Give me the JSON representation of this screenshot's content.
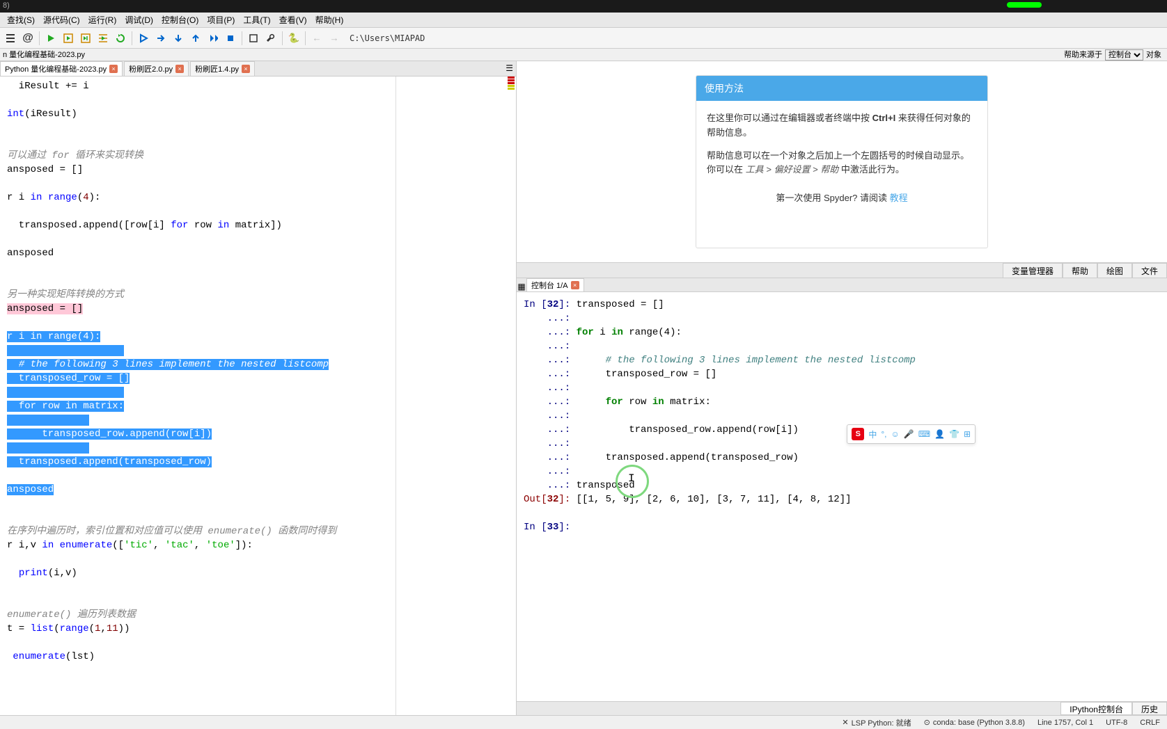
{
  "titlebar": {
    "text": "8)"
  },
  "menu": [
    "查找(S)",
    "源代码(C)",
    "运行(R)",
    "调试(D)",
    "控制台(O)",
    "项目(P)",
    "工具(T)",
    "查看(V)",
    "帮助(H)"
  ],
  "toolbar_path": "C:\\Users\\MIAPAD",
  "breadcrumb_left": "n 量化编程基础-2023.py",
  "breadcrumb_right_label": "帮助来源于",
  "breadcrumb_select": "控制台",
  "breadcrumb_object": "对象",
  "editor_tabs": [
    {
      "label": "Python 量化编程基础-2023.py",
      "active": true
    },
    {
      "label": "粉刷匠2.0.py",
      "active": false
    },
    {
      "label": "粉刷匠1.4.py",
      "active": false
    }
  ],
  "help": {
    "title": "使用方法",
    "p1a": "在这里你可以通过在编辑器或者终端中按 ",
    "p1b": "Ctrl+I",
    "p1c": " 来获得任何对象的帮助信息。",
    "p2a": "帮助信息可以在一个对象之后加上一个左圆括号的时候自动显示。你可以在 ",
    "p2b": "工具 > 偏好设置 > 帮助",
    "p2c": " 中激活此行为。",
    "footer_a": "第一次使用 Spyder? 请阅读 ",
    "footer_link": "教程"
  },
  "right_tabs": [
    "变量管理器",
    "帮助",
    "绘图",
    "文件"
  ],
  "console_tab": "控制台 1/A",
  "bottom_tabs": [
    "IPython控制台",
    "历史"
  ],
  "status": {
    "lsp": "LSP Python: 就绪",
    "conda": "conda: base (Python 3.8.8)",
    "pos": "Line 1757, Col 1",
    "enc": "UTF-8",
    "eol": "CRLF"
  },
  "ime": {
    "s": "S",
    "zhong": "中"
  },
  "console": {
    "in_prefix": "In [",
    "in_num": "32",
    "out_prefix": "Out[",
    "out_num": "32",
    "in33": "33",
    "line1": "transposed = []",
    "line2a": "for",
    "line2b": " i ",
    "line2c": "in",
    "line2d": " range(4):",
    "line3": "     # the following 3 lines implement the nested listcomp",
    "line4": "     transposed_row = []",
    "line5a": "     for",
    "line5b": " row ",
    "line5c": "in",
    "line5d": " matrix:",
    "line6": "         transposed_row.append(row[i])",
    "line7": "     transposed.append(transposed_row)",
    "line8": "transposed",
    "out_val": "[[1, 5, 9], [2, 6, 10], [3, 7, 11], [4, 8, 12]]"
  }
}
